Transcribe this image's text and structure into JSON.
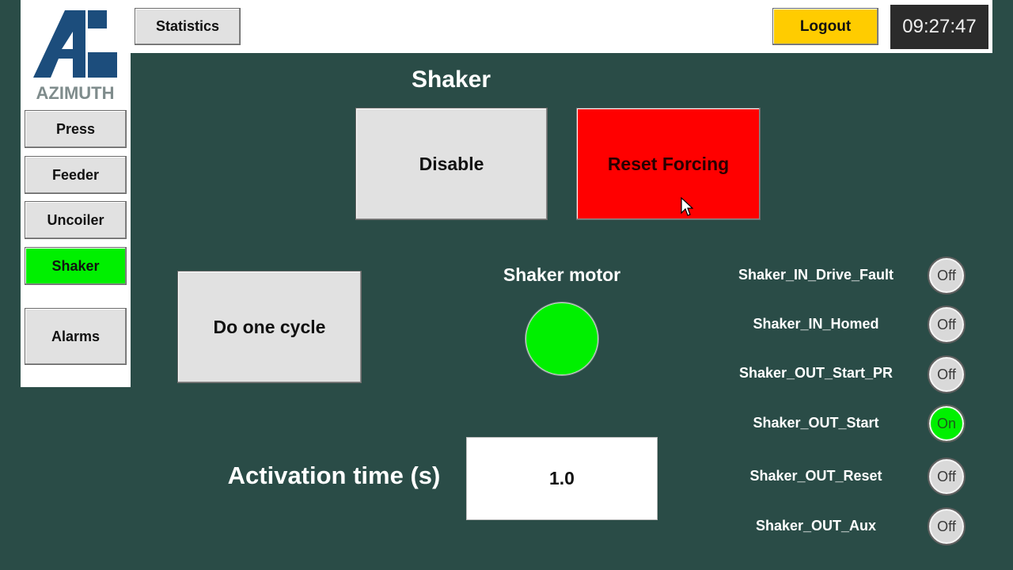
{
  "header": {
    "statistics_label": "Statistics",
    "logout_label": "Logout",
    "clock": "09:27:47"
  },
  "logo": {
    "text": "AZIMUTH",
    "color": "#1c4d7c",
    "text_color": "#7f8c8c"
  },
  "sidebar": {
    "items": [
      {
        "label": "Press",
        "active": false
      },
      {
        "label": "Feeder",
        "active": false
      },
      {
        "label": "Uncoiler",
        "active": false
      },
      {
        "label": "Shaker",
        "active": true
      },
      {
        "label": "Alarms",
        "active": false
      }
    ]
  },
  "main": {
    "title": "Shaker",
    "disable_label": "Disable",
    "reset_forcing_label": "Reset Forcing",
    "do_one_cycle_label": "Do one cycle",
    "motor": {
      "label": "Shaker motor",
      "state": "on"
    },
    "activation": {
      "label": "Activation time (s)",
      "value": "1.0"
    },
    "io": [
      {
        "name": "Shaker_IN_Drive_Fault",
        "status": "Off"
      },
      {
        "name": "Shaker_IN_Homed",
        "status": "Off"
      },
      {
        "name": "Shaker_OUT_Start_PR",
        "status": "Off"
      },
      {
        "name": "Shaker_OUT_Start",
        "status": "On"
      },
      {
        "name": "Shaker_OUT_Reset",
        "status": "Off"
      },
      {
        "name": "Shaker_OUT_Aux",
        "status": "Off"
      }
    ]
  },
  "colors": {
    "background": "#2a4c47",
    "active_green": "#00f000",
    "reset_red": "#ff0000",
    "logout_yellow": "#ffcc00"
  }
}
